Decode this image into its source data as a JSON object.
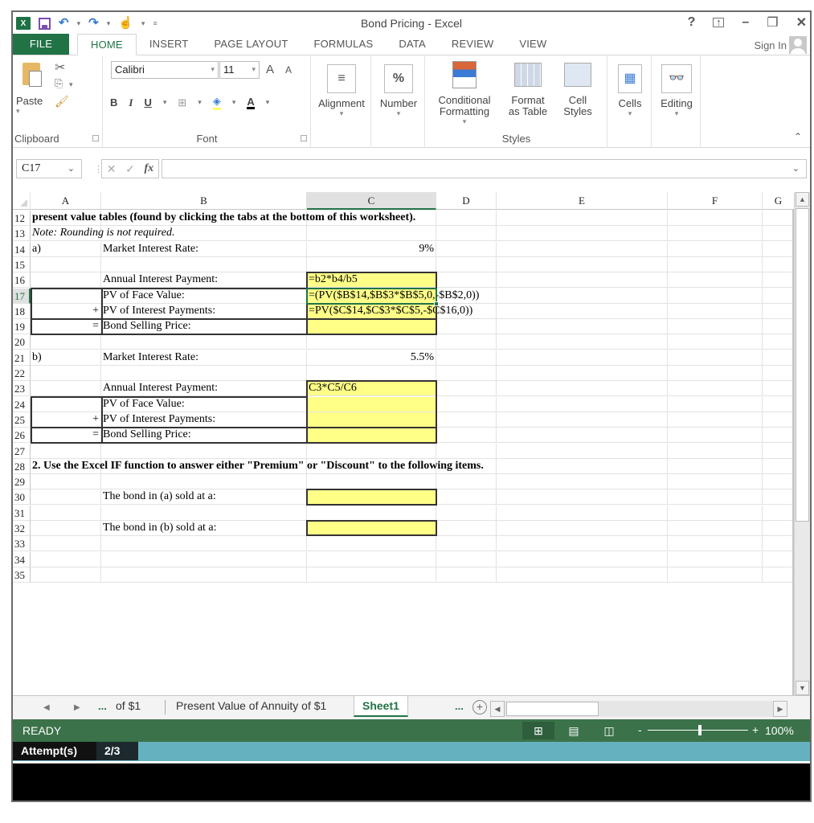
{
  "window": {
    "title": "Bond Pricing - Excel",
    "controls": [
      "?",
      "ribbon-display-options",
      "minimize",
      "restore",
      "close"
    ]
  },
  "ribbon": {
    "tabs": [
      {
        "label": "FILE"
      },
      {
        "label": "HOME",
        "active": true
      },
      {
        "label": "INSERT"
      },
      {
        "label": "PAGE LAYOUT"
      },
      {
        "label": "FORMULAS"
      },
      {
        "label": "DATA"
      },
      {
        "label": "REVIEW"
      },
      {
        "label": "VIEW"
      }
    ],
    "sign_in": "Sign In",
    "clipboard": {
      "paste": "Paste",
      "group": "Clipboard"
    },
    "font": {
      "name": "Calibri",
      "size": "11",
      "group": "Font",
      "bold": "B",
      "italic": "I",
      "underline": "U",
      "grow": "A",
      "shrink": "A"
    },
    "alignment": {
      "label": "Alignment"
    },
    "number": {
      "label": "Number",
      "icon": "%"
    },
    "styles": {
      "conditional_1": "Conditional",
      "conditional_2": "Formatting",
      "format_table_1": "Format",
      "format_table_2": "as Table",
      "cell_styles_1": "Cell",
      "cell_styles_2": "Styles",
      "group": "Styles"
    },
    "cells": {
      "label": "Cells"
    },
    "editing": {
      "label": "Editing"
    }
  },
  "formula_bar": {
    "name_box": "C17",
    "formula": ""
  },
  "grid": {
    "columns": [
      "A",
      "B",
      "C",
      "D",
      "E",
      "F",
      "G"
    ],
    "selected_column": "C",
    "selected_row": "17",
    "rows": [
      {
        "num": "12",
        "A": "present value tables (found by clicking the tabs at the bottom of this worksheet).",
        "bold": true
      },
      {
        "num": "13",
        "A": "Note:  Rounding is not required.",
        "italic": true
      },
      {
        "num": "14",
        "A": "a)",
        "B": "Market Interest Rate:",
        "C": "9%"
      },
      {
        "num": "15"
      },
      {
        "num": "16",
        "B": "Annual Interest Payment:",
        "C": "=b2*b4/b5"
      },
      {
        "num": "17",
        "B": "PV of Face Value:",
        "C": "=(PV($B$14,$B$3*$B$5,0,-$B$2,0))"
      },
      {
        "num": "18",
        "A": "+",
        "B": "PV of Interest Payments:",
        "C": "=PV($C$14,$C$3*$C$5,-$C$16,0))"
      },
      {
        "num": "19",
        "A": "=",
        "B": "Bond Selling Price:",
        "C": ""
      },
      {
        "num": "20"
      },
      {
        "num": "21",
        "A": "b)",
        "B": "Market Interest Rate:",
        "C": "5.5%"
      },
      {
        "num": "22"
      },
      {
        "num": "23",
        "B": "Annual Interest Payment:",
        "C": "C3*C5/C6"
      },
      {
        "num": "24",
        "B": "PV of Face Value:",
        "C": ""
      },
      {
        "num": "25",
        "A": "+",
        "B": "PV of Interest Payments:",
        "C": ""
      },
      {
        "num": "26",
        "A": "=",
        "B": "Bond Selling Price:",
        "C": ""
      },
      {
        "num": "27"
      },
      {
        "num": "28",
        "A": "2. Use the Excel IF function to answer either \"Premium\" or \"Discount\" to the following items.",
        "bold": true
      },
      {
        "num": "29"
      },
      {
        "num": "30",
        "B": "The bond in (a) sold at a:",
        "C": ""
      },
      {
        "num": "31"
      },
      {
        "num": "32",
        "B": "The bond in (b) sold at a:",
        "C": ""
      },
      {
        "num": "33"
      },
      {
        "num": "34"
      },
      {
        "num": "35"
      }
    ]
  },
  "sheet_tabs": {
    "ellipsis": "...",
    "tabs": [
      {
        "label": "of $1"
      },
      {
        "label": "Present Value of Annuity of $1"
      },
      {
        "label": "Sheet1",
        "active": true
      }
    ],
    "add": "+"
  },
  "status_bar": {
    "status": "READY",
    "zoom": "100%",
    "zoom_minus": "-",
    "zoom_plus": "+",
    "zoom_level_percent": 100
  },
  "attempts": {
    "label": "Attempt(s)",
    "value": "2/3"
  },
  "colors": {
    "excel_green": "#217346",
    "status_green": "#3b7249",
    "input_yellow": "#ffff88",
    "attempts_teal": "#66b1c0"
  }
}
